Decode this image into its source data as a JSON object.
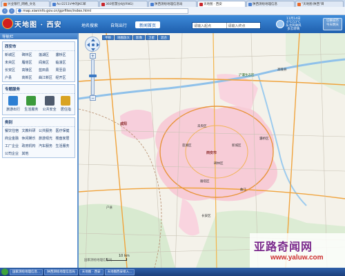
{
  "browser": {
    "tabs": [
      {
        "label": "兴业银行_网络_文化",
        "active": false
      },
      {
        "label": "Acr2211V中的JKC邮",
        "active": false
      },
      {
        "label": "360智慧分站(RNG)",
        "active": false
      },
      {
        "label": "陕西测绘地理信息局",
        "active": false
      },
      {
        "label": "天地图 · 西安",
        "active": true
      },
      {
        "label": "陕西测绘地理信息",
        "active": false
      },
      {
        "label": "\"天地图·陕西\"目",
        "active": false
      }
    ],
    "url": "map.xianinfo.gov.cn/gprfiles/index.html"
  },
  "site": {
    "logo_text": "天地图 · 西安",
    "nav": [
      {
        "label": "地名搜索",
        "active": false
      },
      {
        "label": "自驾出行",
        "active": false
      },
      {
        "label": "新闻首页",
        "active": true
      }
    ],
    "search": {
      "field1": "请输入起点",
      "field2": "请输入终点"
    },
    "weather": {
      "date": "11月14日",
      "temp": "4℃/13℃",
      "wind": "东北风微风",
      "aqi": "多云转晴"
    },
    "weather_button": {
      "line1": "切换城市",
      "line2": "今天明天"
    }
  },
  "sidebar": {
    "title": "导航栏",
    "districts_title": "西安市",
    "districts": [
      "新城区",
      "碑林区",
      "莲湖区",
      "灞桥区",
      "未央区",
      "雁塔区",
      "阎良区",
      "临潼区",
      "长安区",
      "高陵区",
      "蓝田县",
      "周至县",
      "户县",
      "高新区",
      "曲江新区",
      "经开区"
    ],
    "services_title": "专题服务",
    "services": [
      {
        "label": "旅游出行",
        "icon": "travel-icon",
        "color": "#2d7fd3"
      },
      {
        "label": "生活服务",
        "icon": "life-service-icon",
        "color": "#3b9a3b"
      },
      {
        "label": "公共安全",
        "icon": "public-safety-icon",
        "color": "#4f5b6e"
      },
      {
        "label": "居住指",
        "icon": "residence-icon",
        "color": "#d9a322"
      }
    ],
    "categories_title": "类别",
    "categories": [
      "餐饮住宿",
      "文教科研",
      "公共服务",
      "医疗保健",
      "商业金融",
      "休闲娱乐",
      "旅游观光",
      "楼盘家居",
      "工厂企业",
      "政府机构",
      "汽车服务",
      "生活服务",
      "公司企业",
      "其他"
    ]
  },
  "map": {
    "maptabs": [
      "平移",
      "地图放大",
      "影像",
      "卫星",
      "混合"
    ],
    "labels": {
      "xianyang": "咸阳",
      "city": "西安市",
      "weiyang": "未央区",
      "lianhu": "莲湖区",
      "xincheng": "新城区",
      "beilin": "碑林区",
      "yanta": "雁塔区",
      "baqiao": "灞桥区",
      "changan": "长安区",
      "gaoling": "高陵县",
      "huxian": "户县",
      "chanba": "浐灞生态区",
      "qujiang": "曲江"
    },
    "scale": "10 km",
    "copyright": "国家测绘地理信息局"
  },
  "watermark": {
    "cn": "亚路奇闻网",
    "url": "www.yaluw.com"
  },
  "taskbar": {
    "tasks": [
      "国家测绘地理信息...",
      "陕西测绘地理信息局",
      "天地图 · 西安",
      "天地图西安接入..."
    ]
  },
  "colors": {
    "brand_blue": "#2f74c7",
    "urban_pink": "#f6c8d6"
  }
}
